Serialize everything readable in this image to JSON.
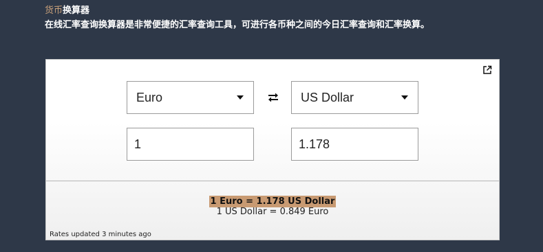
{
  "header": {
    "crumb": "货币",
    "title": "换算器",
    "subtitle": "在线汇率查询换算器是非常便捷的汇率查询工具，可进行各币种之间的今日汇率查询和汇率换算。"
  },
  "converter": {
    "from_currency": "Euro",
    "to_currency": "US Dollar",
    "from_amount": "1",
    "to_amount": "1.178",
    "result_main": "1 Euro = 1.178 US Dollar",
    "result_sub": "1 US Dollar = 0.849 Euro",
    "updated": "Rates updated 3 minutes ago",
    "accent_color": "#c89a72"
  },
  "icons": {
    "external": "external-link-icon",
    "swap": "swap-arrows-icon",
    "caret": "chevron-down-icon"
  }
}
